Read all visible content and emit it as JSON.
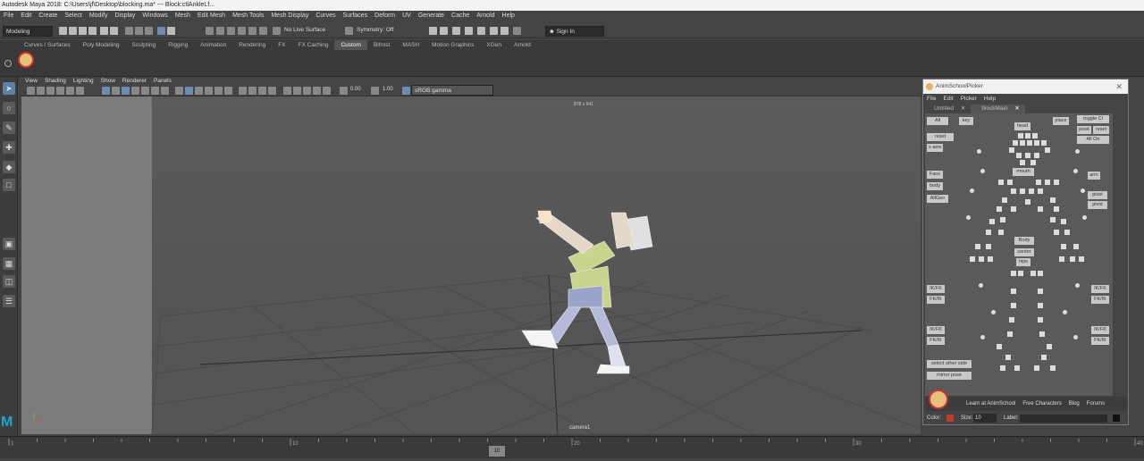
{
  "title_bar": {
    "text": "Autodesk Maya 2018: C:\\Users\\jf\\Desktop\\blocking.ma*  ---  Block:ctlAnkleLf..."
  },
  "menu": [
    "File",
    "Edit",
    "Create",
    "Select",
    "Modify",
    "Display",
    "Windows",
    "Mesh",
    "Edit Mesh",
    "Mesh Tools",
    "Mesh Display",
    "Curves",
    "Surfaces",
    "Deform",
    "UV",
    "Generate",
    "Cache",
    "Arnold",
    "Help"
  ],
  "status": {
    "workspace": "Modeling",
    "live_surface": "No Live Surface",
    "symmetry": "Symmetry: Off",
    "sign_in": "Sign In"
  },
  "shelf_tabs": [
    "Curves / Surfaces",
    "Poly Modeling",
    "Sculpting",
    "Rigging",
    "Animation",
    "Rendering",
    "FX",
    "FX Caching",
    "Custom",
    "Bifrost",
    "MASH",
    "Motion Graphics",
    "XGen",
    "Arnold"
  ],
  "active_shelf": "Custom",
  "panel_menu": [
    "View",
    "Shading",
    "Lighting",
    "Show",
    "Renderer",
    "Panels"
  ],
  "panel_toolbar": {
    "exposure": "0.00",
    "gamma": "1.00",
    "color_space": "sRGB gamma"
  },
  "viewport": {
    "camera": "camera1",
    "resolution": "878 x 941"
  },
  "timeline": {
    "ticks": [
      "1",
      "",
      "",
      "",
      "",
      "",
      "",
      "",
      "",
      "",
      "10",
      "",
      "",
      "",
      "",
      "",
      "",
      "",
      "",
      "",
      "20",
      "",
      "",
      "",
      "",
      "",
      "",
      "",
      "",
      "",
      "30",
      "",
      "",
      "",
      "",
      "",
      "",
      "",
      "",
      "",
      "40"
    ],
    "current_frame": "10"
  },
  "picker": {
    "title": "AnimSchoolPicker",
    "menu": [
      "File",
      "Edit",
      "Picker",
      "Help"
    ],
    "tabs": [
      "Untitled",
      "blockMain"
    ],
    "buttons": {
      "all": "All",
      "key": "key",
      "reset": "reset",
      "xaxis": "x-axis",
      "face": "Face",
      "body": "body",
      "all_geo": "AllGeo",
      "head": "head",
      "place": "place",
      "toggle": "toggle Cl",
      "posit": "posit",
      "reset2": "reset",
      "all_on": "All On",
      "mouth": "mouth",
      "body_lbl": "Body",
      "center": "center",
      "hips": "hips",
      "arm": "arm",
      "pivot1": "pivot",
      "pivot2": "pivot",
      "ik_fk_l1": "IK/FK",
      "ik_fk_r1": "IK/FK",
      "ik_fk_l2": "IK/FK",
      "ik_fk_r2": "IK/FK",
      "fk_ik_l1": "FK/IK",
      "fk_ik_r1": "FK/IK",
      "fk_ik_l2": "FK/IK",
      "fk_ik_r2": "FK/IK",
      "select_other": "select other side",
      "mirror_pose": "mirror pose"
    },
    "footer_links": [
      "Learn at AnimSchool",
      "Free Characters",
      "Blog",
      "Forums"
    ],
    "bottom": {
      "color_label": "Color:",
      "size_label": "Size:",
      "size_value": "10",
      "label_label": "Label:"
    }
  },
  "colors": {
    "accent": "#5f7fa3",
    "maya_logo": "#1fa3d6",
    "picker_color": "#c0392b"
  }
}
